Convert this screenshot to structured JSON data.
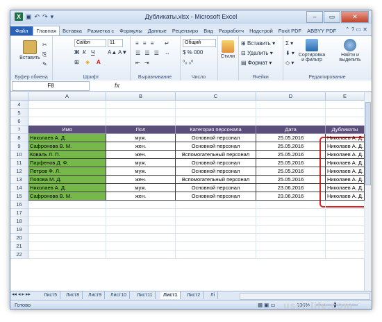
{
  "window": {
    "title": "Дубликаты.xlsx - Microsoft Excel",
    "qat_icons": [
      "excel-logo-icon",
      "save-icon",
      "undo-icon",
      "redo-icon",
      "customize-icon"
    ],
    "buttons": {
      "minimize": "–",
      "restore": "▭",
      "close": "✕"
    }
  },
  "tabs": [
    "Файл",
    "Главная",
    "Вставка",
    "Разметка с",
    "Формулы",
    "Данные",
    "Рецензиро",
    "Вид",
    "Разработч",
    "Надстрой",
    "Foxit PDF",
    "ABBYY PDF"
  ],
  "ribbon": {
    "clipboard": {
      "paste": "Вставить",
      "label": "Буфер обмена"
    },
    "font": {
      "name": "Calibri",
      "size": "11",
      "bold": "Ж",
      "italic": "К",
      "underline": "Ч",
      "label": "Шрифт"
    },
    "alignment": {
      "label": "Выравнивание"
    },
    "number": {
      "format": "Общий",
      "label": "Число"
    },
    "styles": {
      "styles": "Стили",
      "label": ""
    },
    "cells": {
      "insert": "Вставить",
      "delete": "Удалить",
      "format": "Формат",
      "label": "Ячейки"
    },
    "editing": {
      "sort": "Сортировка и фильтр",
      "sort_line1": "Сортировка",
      "sort_line2": "и фильтр",
      "find_line1": "Найти и",
      "find_line2": "выделить",
      "label": "Редактирование"
    }
  },
  "formula_bar": {
    "name_box": "F8",
    "fx": "fx",
    "value": ""
  },
  "columns": [
    "A",
    "B",
    "C",
    "D",
    "E"
  ],
  "rows": [
    "4",
    "5",
    "6",
    "7",
    "8",
    "9",
    "10",
    "11",
    "12",
    "13",
    "14",
    "15",
    "16",
    "17",
    "18",
    "19",
    "20",
    "21",
    "22"
  ],
  "table": {
    "headers": [
      "Имя",
      "Пол",
      "Категория персонала",
      "Дата",
      "Дубликаты"
    ],
    "rows": [
      [
        "Николаев А. Д.",
        "муж.",
        "Основной персонал",
        "25.05.2016",
        "Николаев А. Д."
      ],
      [
        "Сафронова В. М.",
        "жен.",
        "Основной персонал",
        "25.05.2016",
        "Николаев А. Д."
      ],
      [
        "Коваль Л. П.",
        "жен.",
        "Вспомогательный персонал",
        "25.05.2016",
        "Николаев А. Д."
      ],
      [
        "Парфенов Д. Ф.",
        "муж.",
        "Основной персонал",
        "25.05.2016",
        "Николаев А. Д."
      ],
      [
        "Петров Ф. Л.",
        "муж.",
        "Основной персонал",
        "25.05.2016",
        "Николаев А. Д."
      ],
      [
        "Попова М. Д.",
        "жен.",
        "Вспомогательный персонал",
        "25.05.2016",
        "Николаев А. Д."
      ],
      [
        "Николаев А. Д.",
        "муж.",
        "Основной персонал",
        "23.06.2016",
        "Николаев А. Д."
      ],
      [
        "Сафронова В. М.",
        "жен.",
        "Основной персонал",
        "23.06.2016",
        "Николаев А. Д."
      ]
    ]
  },
  "sheets": [
    "Лист5",
    "Лист8",
    "Лист9",
    "Лист10",
    "Лист11",
    "Лист1",
    "Лист2",
    "Лі"
  ],
  "active_sheet": "Лист1",
  "status": {
    "ready": "Готово",
    "zoom": "100%"
  },
  "watermark": "user-life.com"
}
